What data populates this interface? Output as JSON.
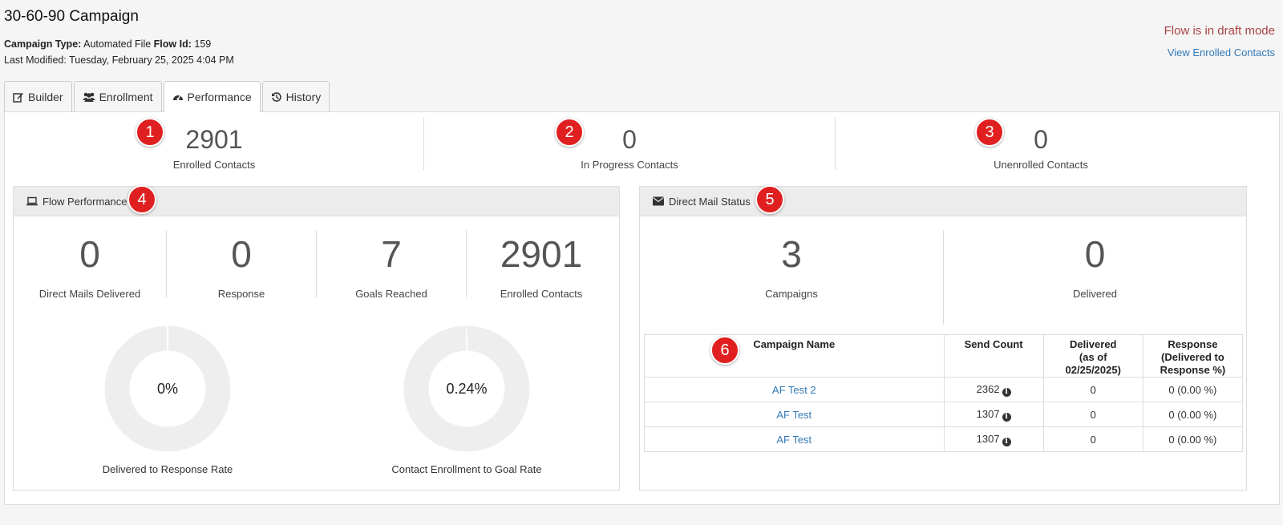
{
  "page": {
    "title": "30-60-90 Campaign",
    "campaign_type_label": "Campaign Type:",
    "campaign_type_value": "Automated File",
    "flow_id_label": "Flow Id:",
    "flow_id_value": "159",
    "last_modified": "Last Modified: Tuesday, February 25, 2025 4:04 PM",
    "draft_status": "Flow is in draft mode",
    "view_enrolled_link": "View Enrolled Contacts"
  },
  "tabs": [
    {
      "label": "Builder",
      "icon": "edit-icon",
      "active": false
    },
    {
      "label": "Enrollment",
      "icon": "users-icon",
      "active": false
    },
    {
      "label": "Performance",
      "icon": "dashboard-icon",
      "active": true
    },
    {
      "label": "History",
      "icon": "history-icon",
      "active": false
    }
  ],
  "summary": {
    "enrolled": {
      "value": "2901",
      "label": "Enrolled Contacts"
    },
    "in_progress": {
      "value": "0",
      "label": "In Progress Contacts"
    },
    "unenrolled": {
      "value": "0",
      "label": "Unenrolled Contacts"
    }
  },
  "badges": [
    "1",
    "2",
    "3",
    "4",
    "5",
    "6"
  ],
  "flow_performance": {
    "title": "Flow Performance",
    "icon": "laptop-icon",
    "stats": [
      {
        "value": "0",
        "label": "Direct Mails Delivered"
      },
      {
        "value": "0",
        "label": "Response"
      },
      {
        "value": "7",
        "label": "Goals Reached"
      },
      {
        "value": "2901",
        "label": "Enrolled Contacts"
      }
    ],
    "donuts": [
      {
        "value_text": "0%",
        "fraction": 0.0,
        "caption": "Delivered to Response Rate"
      },
      {
        "value_text": "0.24%",
        "fraction": 0.0024,
        "caption": "Contact Enrollment to Goal Rate"
      }
    ]
  },
  "direct_mail": {
    "title": "Direct Mail Status",
    "icon": "envelope-icon",
    "stats": [
      {
        "value": "3",
        "label": "Campaigns"
      },
      {
        "value": "0",
        "label": "Delivered"
      }
    ],
    "table": {
      "headers": [
        "Campaign Name",
        "Send Count",
        "Delivered (as of 02/25/2025)",
        "Response (Delivered to Response %)"
      ],
      "header_lines": [
        [
          "Campaign Name"
        ],
        [
          "Send Count"
        ],
        [
          "Delivered",
          "(as of",
          "02/25/2025)"
        ],
        [
          "Response",
          "(Delivered to",
          "Response %)"
        ]
      ],
      "rows": [
        {
          "name": "AF Test 2",
          "send_count": "2362",
          "delivered": "0",
          "response": "0 (0.00 %)"
        },
        {
          "name": "AF Test",
          "send_count": "1307",
          "delivered": "0",
          "response": "0 (0.00 %)"
        },
        {
          "name": "AF Test",
          "send_count": "1307",
          "delivered": "0",
          "response": "0 (0.00 %)"
        }
      ]
    }
  },
  "colors": {
    "accent_link": "#337ab7",
    "draft_red": "#a94442",
    "badge_red": "#e02020",
    "donut_track": "#eeeeee",
    "donut_fill": "#337ab7"
  }
}
